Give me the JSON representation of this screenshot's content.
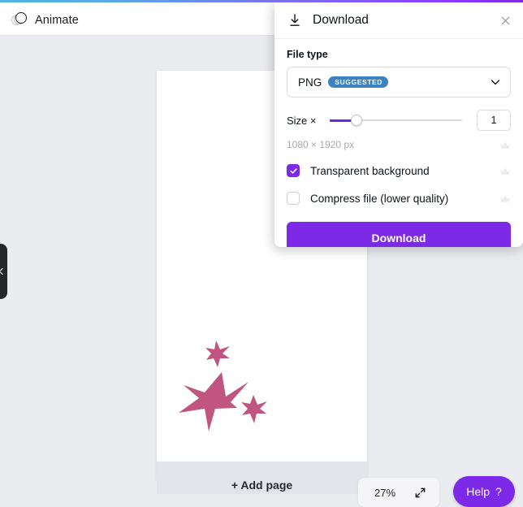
{
  "toolbar": {
    "animate_label": "Animate",
    "animate_icon": "layered-circles-icon"
  },
  "canvas": {
    "add_page_label": "+ Add page",
    "artwork": {
      "description": "three pink stars",
      "color": "#c0557f"
    }
  },
  "bottom_controls": {
    "zoom_level": "27%",
    "expand_icon": "expand-arrows-icon",
    "help_label": "Help",
    "help_suffix": "?"
  },
  "left_panel": {
    "collapse_icon": "chevron-left-icon"
  },
  "download_panel": {
    "title": "Download",
    "title_icon": "download-icon",
    "close_icon": "close-icon",
    "file_type": {
      "label": "File type",
      "selected": "PNG",
      "badge": "SUGGESTED",
      "badge_color": "#3d82c0",
      "chevron_icon": "chevron-down-icon"
    },
    "size": {
      "label": "Size ×",
      "value": "1",
      "slider_percent": 18,
      "dimensions": "1080 × 1920 px"
    },
    "options": [
      {
        "label": "Transparent background",
        "checked": true,
        "premium_icon": "crown-icon"
      },
      {
        "label": "Compress file (lower quality)",
        "checked": false,
        "premium_icon": "crown-icon"
      }
    ],
    "dimensions_premium_icon": "crown-icon",
    "download_button_label": "Download",
    "accent_color": "#7d2ae8"
  }
}
